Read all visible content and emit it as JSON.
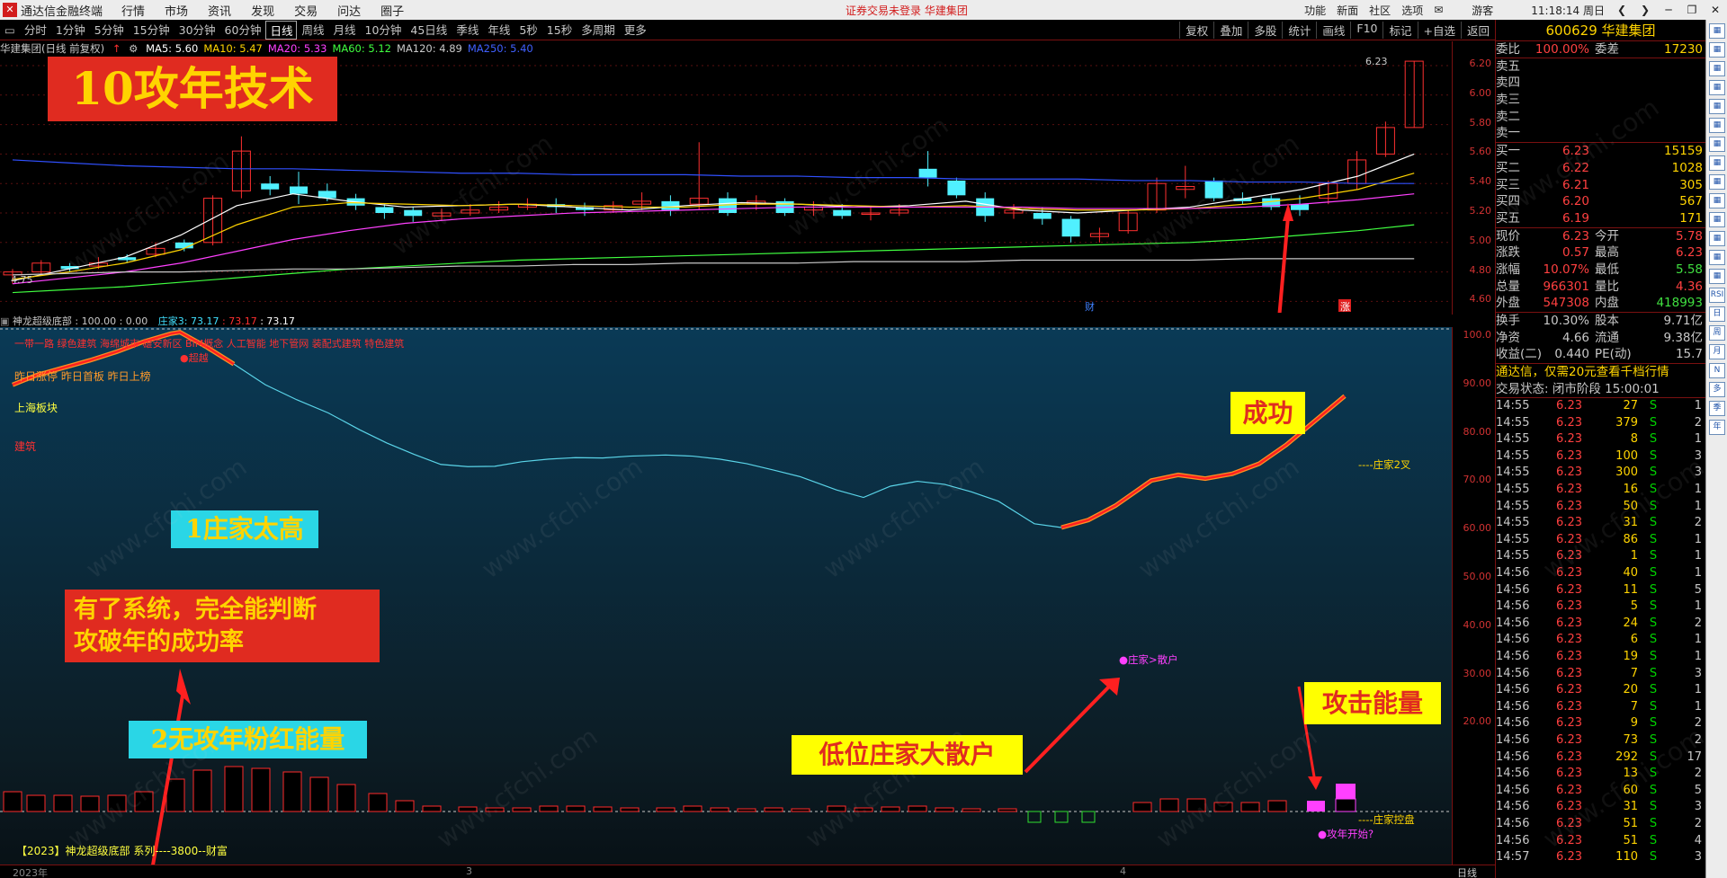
{
  "app": {
    "title": "通达信金融终端",
    "menu": [
      "行情",
      "市场",
      "资讯",
      "发现",
      "交易",
      "问达",
      "圈子"
    ],
    "notice": "证券交易未登录  华建集团",
    "right_items": [
      "功能",
      "新面",
      "社区",
      "选项"
    ],
    "user": "游客",
    "clock": "11:18:14 周日"
  },
  "periods": [
    "分时",
    "1分钟",
    "5分钟",
    "15分钟",
    "30分钟",
    "60分钟",
    "日线",
    "周线",
    "月线",
    "10分钟",
    "45日线",
    "季线",
    "年线",
    "5秒",
    "15秒",
    "多周期",
    "更多"
  ],
  "active_period": "日线",
  "toolbar_right": [
    "复权",
    "叠加",
    "多股",
    "统计",
    "画线",
    "F10",
    "标记",
    "+自选",
    "返回"
  ],
  "main": {
    "name": "华建集团(日线 前复权)",
    "ma": [
      {
        "label": "MA5: 5.60",
        "color": "#ffffff"
      },
      {
        "label": "MA10: 5.47",
        "color": "#ffd400"
      },
      {
        "label": "MA20: 5.33",
        "color": "#ff40ff"
      },
      {
        "label": "MA60: 5.12",
        "color": "#40ff40"
      },
      {
        "label": "MA120: 4.89",
        "color": "#c8c8c8"
      },
      {
        "label": "MA250: 5.40",
        "color": "#4060ff"
      }
    ],
    "yticks": [
      "6.20",
      "6.00",
      "5.80",
      "5.60",
      "5.40",
      "5.20",
      "5.00",
      "4.80",
      "4.60"
    ],
    "high_label": "6.23",
    "low_label": "4.75",
    "markers": [
      "财",
      "涨"
    ]
  },
  "indicator": {
    "header": "神龙超级底部 : 100.00 : 0.00",
    "zj": "庄家3: 73.17",
    "v2": ": 73.17",
    "v3": ": 73.17",
    "yticks": [
      "100.0",
      "90.00",
      "80.00",
      "70.00",
      "60.00",
      "50.00",
      "40.00",
      "30.00",
      "20.00"
    ],
    "top_text": "一带一路 绿色建筑 海绵城市 雄安新区 BIM概念 人工智能 地下管网 装配式建筑 特色建筑",
    "yesterday": "昨日涨停 昨日首板 昨日上榜",
    "sector": "上海板块",
    "build": "建筑",
    "peak_label": "●超越",
    "zj2": "----庄家2叉",
    "zj_san": "●庄家>散户",
    "zj_ctrl": "----庄家控盘",
    "attack_start": "●攻年开始?",
    "footer": "【2023】神龙超级底部 系列----3800--财富",
    "date_left": "2023年",
    "date_mid": "3",
    "date_mid2": "4",
    "date_right": "日线"
  },
  "overlays": {
    "t1": "10攻年技术",
    "t2": "1庄家太高",
    "t3": "有了系统，完全能判断\n攻破年的成功率",
    "t4": "2无攻年粉红能量",
    "t5": "低位庄家大散户",
    "t6": "攻击能量",
    "t7": "成功"
  },
  "watermark": "www.cfchi.com",
  "quote": {
    "code": "600629 华建集团",
    "wb": "100.00%",
    "wc": "17230",
    "sell": [
      "卖五",
      "卖四",
      "卖三",
      "卖二",
      "卖一"
    ],
    "buy": [
      {
        "l": "买一",
        "p": "6.23",
        "v": "15159"
      },
      {
        "l": "买二",
        "p": "6.22",
        "v": "1028"
      },
      {
        "l": "买三",
        "p": "6.21",
        "v": "305"
      },
      {
        "l": "买四",
        "p": "6.20",
        "v": "567"
      },
      {
        "l": "买五",
        "p": "6.19",
        "v": "171"
      }
    ],
    "stats": [
      {
        "a": "现价",
        "b": "6.23",
        "c": "今开",
        "d": "5.78"
      },
      {
        "a": "涨跌",
        "b": "0.57",
        "c": "最高",
        "d": "6.23"
      },
      {
        "a": "涨幅",
        "b": "10.07%",
        "c": "最低",
        "d": "5.58"
      },
      {
        "a": "总量",
        "b": "966301",
        "c": "量比",
        "d": "4.36"
      },
      {
        "a": "外盘",
        "b": "547308",
        "c": "内盘",
        "d": "418993"
      }
    ],
    "stats2": [
      {
        "a": "换手",
        "b": "10.30%",
        "c": "股本",
        "d": "9.71亿"
      },
      {
        "a": "净资",
        "b": "4.66",
        "c": "流通",
        "d": "9.38亿"
      },
      {
        "a": "收益(二)",
        "b": "0.440",
        "c": "PE(动)",
        "d": "15.7"
      }
    ],
    "ad": "通达信，仅需20元查看千档行情",
    "state": "交易状态: 闭市阶段 15:00:01",
    "ticks": [
      [
        "14:55",
        "6.23",
        "27",
        "S",
        "1"
      ],
      [
        "14:55",
        "6.23",
        "379",
        "S",
        "2"
      ],
      [
        "14:55",
        "6.23",
        "8",
        "S",
        "1"
      ],
      [
        "14:55",
        "6.23",
        "100",
        "S",
        "3"
      ],
      [
        "14:55",
        "6.23",
        "300",
        "S",
        "3"
      ],
      [
        "14:55",
        "6.23",
        "16",
        "S",
        "1"
      ],
      [
        "14:55",
        "6.23",
        "50",
        "S",
        "1"
      ],
      [
        "14:55",
        "6.23",
        "31",
        "S",
        "2"
      ],
      [
        "14:55",
        "6.23",
        "86",
        "S",
        "1"
      ],
      [
        "14:55",
        "6.23",
        "1",
        "S",
        "1"
      ],
      [
        "14:56",
        "6.23",
        "40",
        "S",
        "1"
      ],
      [
        "14:56",
        "6.23",
        "11",
        "S",
        "5"
      ],
      [
        "14:56",
        "6.23",
        "5",
        "S",
        "1"
      ],
      [
        "14:56",
        "6.23",
        "24",
        "S",
        "2"
      ],
      [
        "14:56",
        "6.23",
        "6",
        "S",
        "1"
      ],
      [
        "14:56",
        "6.23",
        "19",
        "S",
        "1"
      ],
      [
        "14:56",
        "6.23",
        "7",
        "S",
        "3"
      ],
      [
        "14:56",
        "6.23",
        "20",
        "S",
        "1"
      ],
      [
        "14:56",
        "6.23",
        "7",
        "S",
        "1"
      ],
      [
        "14:56",
        "6.23",
        "9",
        "S",
        "2"
      ],
      [
        "14:56",
        "6.23",
        "73",
        "S",
        "2"
      ],
      [
        "14:56",
        "6.23",
        "292",
        "S",
        "17"
      ],
      [
        "14:56",
        "6.23",
        "13",
        "S",
        "2"
      ],
      [
        "14:56",
        "6.23",
        "60",
        "S",
        "5"
      ],
      [
        "14:56",
        "6.23",
        "31",
        "S",
        "3"
      ],
      [
        "14:56",
        "6.23",
        "51",
        "S",
        "2"
      ],
      [
        "14:56",
        "6.23",
        "51",
        "S",
        "4"
      ],
      [
        "14:57",
        "6.23",
        "110",
        "S",
        "3"
      ]
    ]
  },
  "side_tools": [
    "RSI",
    "日",
    "周",
    "月",
    "N",
    "多",
    "季",
    "年"
  ]
}
